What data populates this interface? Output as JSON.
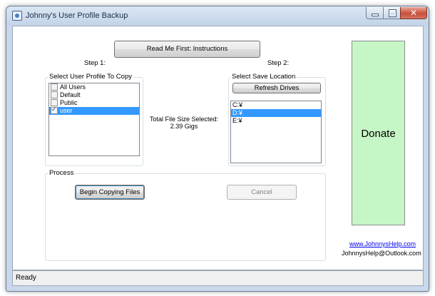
{
  "window": {
    "title": "Johnny's User Profile Backup",
    "controls": {
      "minimize_icon": "minimize-icon",
      "maximize_icon": "maximize-icon",
      "close_icon": "close-icon",
      "close_glyph": "✕"
    }
  },
  "header": {
    "readme_button": "Read Me First:  Instructions"
  },
  "step1": {
    "label": "Step 1:",
    "group_title": "Select User Profile To Copy",
    "profiles": [
      {
        "name": "All Users",
        "checked": false,
        "selected": false
      },
      {
        "name": "Default",
        "checked": false,
        "selected": false
      },
      {
        "name": "Public",
        "checked": false,
        "selected": false
      },
      {
        "name": "user",
        "checked": true,
        "selected": true
      }
    ]
  },
  "size": {
    "label": "Total File Size Selected:",
    "value": "2.39 Gigs"
  },
  "step2": {
    "label": "Step 2:",
    "group_title": "Select Save Location",
    "refresh_button": "Refresh Drives",
    "drives": [
      {
        "name": "C:¥",
        "selected": false
      },
      {
        "name": "D:¥",
        "selected": true
      },
      {
        "name": "E:¥",
        "selected": false
      }
    ]
  },
  "process": {
    "group_title": "Process",
    "begin_button": "Begin Copying Files",
    "cancel_button": "Cancel"
  },
  "donate": {
    "label": "Donate"
  },
  "contact": {
    "website": "www.JohnnysHelp.com",
    "email": "JohnnysHelp@Outlook.com"
  },
  "statusbar": {
    "text": "Ready"
  },
  "colors": {
    "selection": "#3399ff",
    "donate_bg": "#c6f6c5",
    "link": "#0000ee"
  }
}
